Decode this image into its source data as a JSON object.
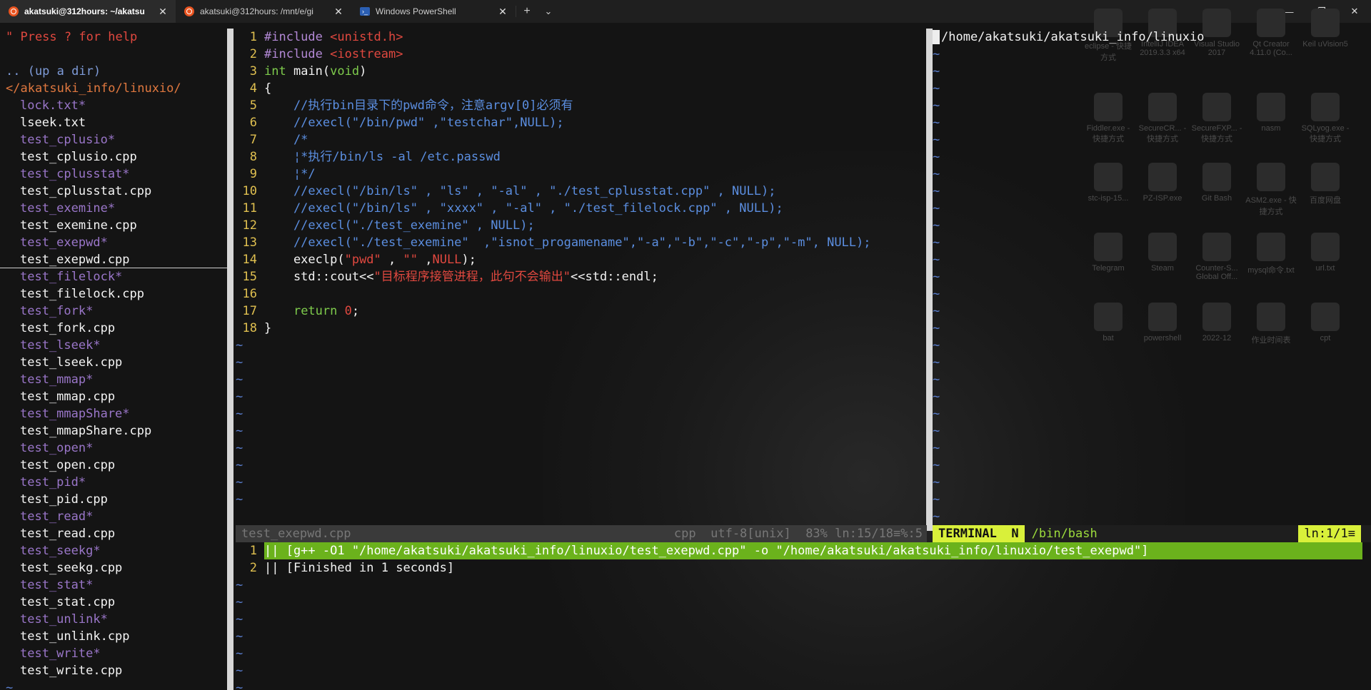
{
  "tabs": [
    {
      "title": "akatsuki@312hours: ~/akatsu",
      "icon": "ubuntu-icon",
      "active": true
    },
    {
      "title": "akatsuki@312hours: /mnt/e/gi",
      "icon": "ubuntu-icon",
      "active": false
    },
    {
      "title": "Windows PowerShell",
      "icon": "powershell-icon",
      "active": false
    }
  ],
  "tabbar": {
    "close_glyph": "✕",
    "new_tab_glyph": "+",
    "dropdown_glyph": "⌄"
  },
  "window_controls": {
    "minimize": "—",
    "maximize": "❐",
    "close": "✕"
  },
  "tree": {
    "help": "\" Press ? for help",
    "updir": ".. (up a dir)",
    "root": "</akatsuki_info/linuxio/",
    "items": [
      {
        "name": "lock.txt*",
        "kind": "exe"
      },
      {
        "name": "lseek.txt",
        "kind": "src"
      },
      {
        "name": "test_cplusio*",
        "kind": "exe"
      },
      {
        "name": "test_cplusio.cpp",
        "kind": "src"
      },
      {
        "name": "test_cplusstat*",
        "kind": "exe"
      },
      {
        "name": "test_cplusstat.cpp",
        "kind": "src"
      },
      {
        "name": "test_exemine*",
        "kind": "exe"
      },
      {
        "name": "test_exemine.cpp",
        "kind": "src"
      },
      {
        "name": "test_exepwd*",
        "kind": "exe"
      },
      {
        "name": "test_exepwd.cpp",
        "kind": "src"
      },
      {
        "name": "test_filelock*",
        "kind": "exe"
      },
      {
        "name": "test_filelock.cpp",
        "kind": "src"
      },
      {
        "name": "test_fork*",
        "kind": "exe"
      },
      {
        "name": "test_fork.cpp",
        "kind": "src"
      },
      {
        "name": "test_lseek*",
        "kind": "exe"
      },
      {
        "name": "test_lseek.cpp",
        "kind": "src"
      },
      {
        "name": "test_mmap*",
        "kind": "exe"
      },
      {
        "name": "test_mmap.cpp",
        "kind": "src"
      },
      {
        "name": "test_mmapShare*",
        "kind": "exe"
      },
      {
        "name": "test_mmapShare.cpp",
        "kind": "src"
      },
      {
        "name": "test_open*",
        "kind": "exe"
      },
      {
        "name": "test_open.cpp",
        "kind": "src"
      },
      {
        "name": "test_pid*",
        "kind": "exe"
      },
      {
        "name": "test_pid.cpp",
        "kind": "src"
      },
      {
        "name": "test_read*",
        "kind": "exe"
      },
      {
        "name": "test_read.cpp",
        "kind": "src"
      },
      {
        "name": "test_seekg*",
        "kind": "exe"
      },
      {
        "name": "test_seekg.cpp",
        "kind": "src"
      },
      {
        "name": "test_stat*",
        "kind": "exe"
      },
      {
        "name": "test_stat.cpp",
        "kind": "src"
      },
      {
        "name": "test_unlink*",
        "kind": "exe"
      },
      {
        "name": "test_unlink.cpp",
        "kind": "src"
      },
      {
        "name": "test_write*",
        "kind": "exe"
      },
      {
        "name": "test_write.cpp",
        "kind": "src"
      }
    ],
    "cursor_item": "test_exepwd.cpp",
    "tilde": "~"
  },
  "editor": {
    "lines": [
      [
        {
          "t": "#include ",
          "c": "pp"
        },
        {
          "t": "<unistd.h>",
          "c": "str"
        }
      ],
      [
        {
          "t": "#include ",
          "c": "pp"
        },
        {
          "t": "<iostream>",
          "c": "str"
        }
      ],
      [
        {
          "t": "int",
          "c": "kw"
        },
        {
          "t": " main(",
          "c": "plain"
        },
        {
          "t": "void",
          "c": "kw"
        },
        {
          "t": ")",
          "c": "plain"
        }
      ],
      [
        {
          "t": "{",
          "c": "plain"
        }
      ],
      [
        {
          "t": "    //执行bin目录下的pwd命令，注意argv[0]必须有",
          "c": "cm"
        }
      ],
      [
        {
          "t": "    //execl(\"/bin/pwd\" ,\"testchar\",NULL);",
          "c": "cm"
        }
      ],
      [
        {
          "t": "    /*",
          "c": "cm"
        }
      ],
      [
        {
          "t": "    ¦*执行/bin/ls -al /etc.passwd",
          "c": "cm"
        }
      ],
      [
        {
          "t": "    ¦*/",
          "c": "cm"
        }
      ],
      [
        {
          "t": "    //execl(\"/bin/ls\" , \"ls\" , \"-al\" , \"./test_cplusstat.cpp\" , NULL);",
          "c": "cm"
        }
      ],
      [
        {
          "t": "    //execl(\"/bin/ls\" , \"xxxx\" , \"-al\" , \"./test_filelock.cpp\" , NULL);",
          "c": "cm"
        }
      ],
      [
        {
          "t": "    //execl(\"./test_exemine\" , NULL);",
          "c": "cm"
        }
      ],
      [
        {
          "t": "    //execl(\"./test_exemine\"  ,\"isnot_progamename\",\"-a\",\"-b\",\"-c\",\"-p\",\"-m\", NULL);",
          "c": "cm"
        }
      ],
      [
        {
          "t": "    execlp(",
          "c": "plain"
        },
        {
          "t": "\"pwd\"",
          "c": "str"
        },
        {
          "t": " , ",
          "c": "plain"
        },
        {
          "t": "\"\"",
          "c": "str"
        },
        {
          "t": " ,",
          "c": "plain"
        },
        {
          "t": "NULL",
          "c": "str"
        },
        {
          "t": ");",
          "c": "plain"
        }
      ],
      [
        {
          "t": "    std::cout<<",
          "c": "plain"
        },
        {
          "t": "\"目标程序接管进程，此句不会输出\"",
          "c": "str"
        },
        {
          "t": "<<std::endl;",
          "c": "plain"
        }
      ],
      [
        {
          "t": "",
          "c": "plain"
        }
      ],
      [
        {
          "t": "    ",
          "c": "plain"
        },
        {
          "t": "return",
          "c": "kw"
        },
        {
          "t": " ",
          "c": "plain"
        },
        {
          "t": "0",
          "c": "num"
        },
        {
          "t": ";",
          "c": "plain"
        }
      ],
      [
        {
          "t": "}",
          "c": "plain"
        }
      ]
    ]
  },
  "status_left": {
    "filename": "test_exepwd.cpp",
    "filetype": "cpp",
    "encoding": "utf-8[unix]",
    "percent": "83%",
    "position": "ln:15/18",
    "column": "≡%:5"
  },
  "terminal": {
    "cwd": "/home/akatsuki/akatsuki_info/linuxio",
    "mode": "TERMINAL",
    "mode_flag": "N",
    "shell": "/bin/bash",
    "position": "ln:1/1≡"
  },
  "quickfix": [
    {
      "num": "1",
      "text": "|| [g++ -O1 \"/home/akatsuki/akatsuki_info/linuxio/test_exepwd.cpp\" -o \"/home/akatsuki/akatsuki_info/linuxio/test_exepwd\"]",
      "highlight": true
    },
    {
      "num": "2",
      "text": "|| [Finished in 1 seconds]",
      "highlight": false
    }
  ],
  "desktop_icons": [
    "eclipse - 快捷方式",
    "IntelliJ IDEA 2019.3.3 x64",
    "Visual Studio 2017",
    "Qt Creator 4.11.0 (Co...",
    "Keil uVision5",
    "Fiddler.exe - 快捷方式",
    "SecureCR... - 快捷方式",
    "SecureFXP... - 快捷方式",
    "nasm",
    "SQLyog.exe - 快捷方式",
    "stc-isp-15...",
    "PZ-ISP.exe",
    "Git Bash",
    "ASM2.exe - 快捷方式",
    "百度网盘",
    "Telegram",
    "Steam",
    "Counter-S... Global Off...",
    "mysql命令.txt",
    "url.txt",
    "bat",
    "powershell",
    "2022-12",
    "作业时间表",
    "cpt"
  ],
  "colors": {
    "accent": "#d9f03a",
    "quickfix_highlight": "#6bb21c",
    "error_red": "#e0483f",
    "exe_purple": "#9a76c9",
    "comment_blue": "#5b8ee0"
  }
}
